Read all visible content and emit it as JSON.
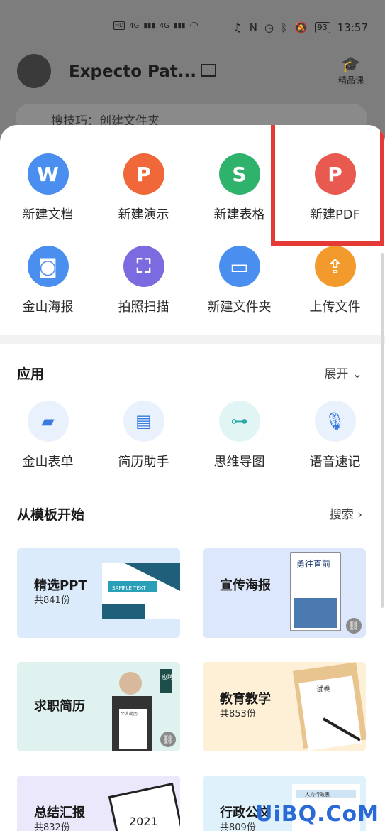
{
  "status": {
    "time": "13:57",
    "battery": "93",
    "network": "4G",
    "hd": "HD"
  },
  "header": {
    "username": "Expecto Pat...",
    "course_label": "精品课"
  },
  "search": {
    "placeholder": "搜技巧：创建文件夹"
  },
  "new_items": [
    {
      "label": "新建文档",
      "letter": "W",
      "color": "#4a8ef0"
    },
    {
      "label": "新建演示",
      "letter": "P",
      "color": "#f0683a"
    },
    {
      "label": "新建表格",
      "letter": "S",
      "color": "#2fb36c"
    },
    {
      "label": "新建PDF",
      "letter": "P",
      "color": "#e85a4f"
    },
    {
      "label": "金山海报",
      "letter": "",
      "color": "#4a8ef0"
    },
    {
      "label": "拍照扫描",
      "letter": "",
      "color": "#7b6be0"
    },
    {
      "label": "新建文件夹",
      "letter": "",
      "color": "#4a8ef0"
    },
    {
      "label": "上传文件",
      "letter": "",
      "color": "#f39a2d"
    }
  ],
  "apps": {
    "title": "应用",
    "expand": "展开",
    "items": [
      {
        "label": "金山表单"
      },
      {
        "label": "简历助手"
      },
      {
        "label": "思维导图"
      },
      {
        "label": "语音速记"
      }
    ]
  },
  "templates": {
    "title": "从模板开始",
    "search": "搜索",
    "cards": [
      {
        "title": "精选PPT",
        "count": "共841份",
        "bg": "#dcebfb"
      },
      {
        "title": "宣传海报",
        "count": "",
        "bg": "#dde7fb",
        "poster_text": "勇往直前"
      },
      {
        "title": "求职简历",
        "count": "",
        "bg": "#dff2ef",
        "badge": "应聘",
        "doc_label": "个人简历"
      },
      {
        "title": "教育教学",
        "count": "共853份",
        "bg": "#fdf0d6",
        "paper_label": "试卷"
      },
      {
        "title": "总结汇报",
        "count": "共832份",
        "bg": "#ece8fb",
        "year": "2021"
      },
      {
        "title": "行政公文",
        "count": "共809份",
        "bg": "#dff1fa",
        "doc_label": "人力行政表"
      }
    ],
    "ppt_sample": "SAMPLE TEXT"
  },
  "watermark": "UiBQ.CoM"
}
